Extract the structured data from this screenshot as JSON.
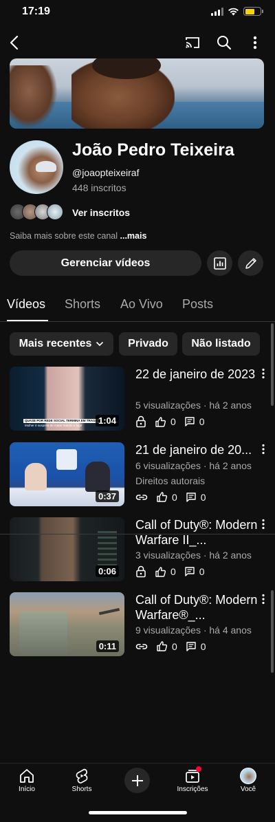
{
  "status": {
    "time": "17:19"
  },
  "channel": {
    "name": "João Pedro Teixeira",
    "handle": "@joaopteixeiraf",
    "subscribers": "448 inscritos",
    "view_subscribers": "Ver inscritos",
    "about": "Saiba mais sobre este canal",
    "about_more": "...mais"
  },
  "actions": {
    "manage_videos": "Gerenciar vídeos"
  },
  "tabs": [
    "Vídeos",
    "Shorts",
    "Ao Vivo",
    "Posts"
  ],
  "filters": {
    "recent": "Mais recentes",
    "private": "Privado",
    "unlisted": "Não listado"
  },
  "videos": [
    {
      "title": "22 de janeiro de 2023",
      "meta": "5 visualizações · há 2 anos",
      "rights": "",
      "duration": "1:04",
      "caption_top": "QUASE POR REDE SOCIAL TERMINA EM TRAGÉDIA",
      "caption_bottom": "Mulher é suspeita de matar marido e fugir",
      "likes": "0",
      "comments": "0",
      "visibility": "lock-icon"
    },
    {
      "title": "21 de janeiro de 20...",
      "meta": "6 visualizações · há 2 anos",
      "rights": "Direitos autorais",
      "duration": "0:37",
      "likes": "0",
      "comments": "0",
      "visibility": "link-icon"
    },
    {
      "title": "Call of Duty®: Modern Warfare II_...",
      "meta": "3 visualizações · há 2 anos",
      "rights": "",
      "duration": "0:06",
      "likes": "0",
      "comments": "0",
      "visibility": "lock-icon"
    },
    {
      "title": "Call of Duty®: Modern Warfare®_...",
      "meta": "9 visualizações · há 4 anos",
      "rights": "",
      "duration": "0:11",
      "likes": "0",
      "comments": "0",
      "visibility": "link-icon"
    }
  ],
  "bottom_nav": [
    "Início",
    "Shorts",
    "Inscrições",
    "Você"
  ],
  "colors": {
    "background": "#0f0f0f",
    "chip": "#272727",
    "notification": "#ff0033",
    "battery": "#f5d20a"
  }
}
